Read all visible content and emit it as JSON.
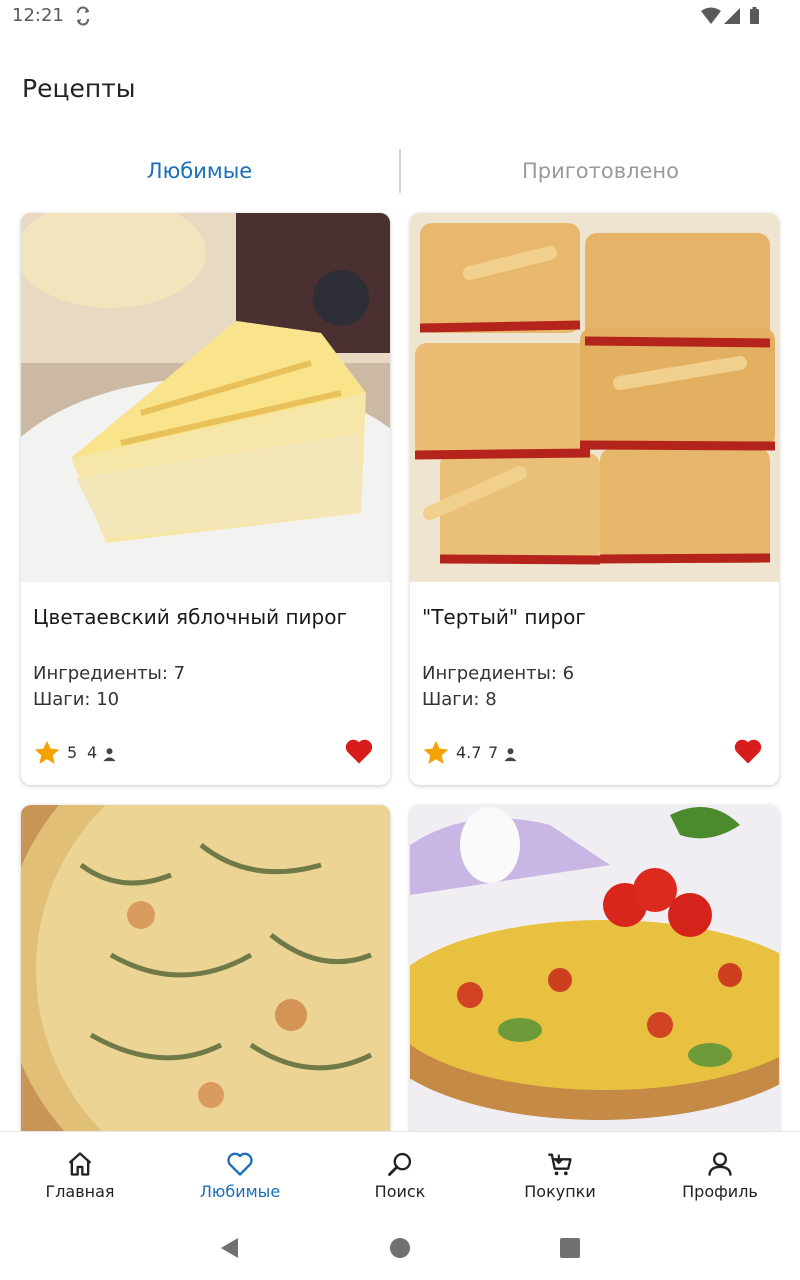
{
  "status_bar": {
    "time": "12:21",
    "icons": [
      "sync-icon",
      "wifi-icon",
      "signal-icon",
      "battery-icon"
    ]
  },
  "page": {
    "title": "Рецепты"
  },
  "tabs": [
    {
      "label": "Любимые",
      "active": true
    },
    {
      "label": "Приготовлено",
      "active": false
    }
  ],
  "recipes": [
    {
      "title": "Цветаевский яблочный пирог",
      "ingredients": "Ингредиенты: 7",
      "steps": "Шаги: 10",
      "rating": "5",
      "votes": "4",
      "favorite": true
    },
    {
      "title": "\"Тертый\" пирог",
      "ingredients": "Ингредиенты: 6",
      "steps": "Шаги: 8",
      "rating": "4.7",
      "votes": "7",
      "favorite": true
    },
    {
      "title": "",
      "ingredients": "",
      "steps": "",
      "rating": "",
      "votes": "",
      "favorite": true
    },
    {
      "title": "",
      "ingredients": "",
      "steps": "",
      "rating": "",
      "votes": "",
      "favorite": true
    }
  ],
  "bottom_nav": [
    {
      "label": "Главная",
      "icon": "home-icon",
      "active": false
    },
    {
      "label": "Любимые",
      "icon": "heart-outline-icon",
      "active": true
    },
    {
      "label": "Поиск",
      "icon": "search-icon",
      "active": false
    },
    {
      "label": "Покупки",
      "icon": "cart-icon",
      "active": false
    },
    {
      "label": "Профиль",
      "icon": "person-icon",
      "active": false
    }
  ],
  "colors": {
    "accent": "#1a6fb8",
    "heart": "#d81b1b",
    "star": "#f5a300",
    "inactive_tab": "#9a9a9a"
  }
}
